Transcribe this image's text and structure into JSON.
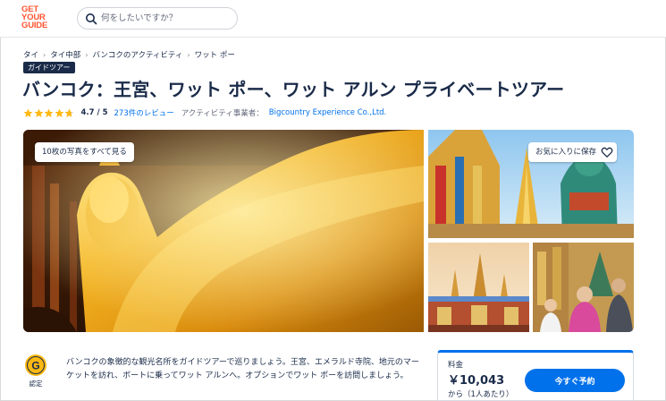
{
  "header": {
    "logo_lines": [
      "GET",
      "YOUR",
      "GUIDE"
    ],
    "search_placeholder": "何をしたいですか？"
  },
  "breadcrumb": [
    "タイ",
    "タイ中部",
    "バンコクのアクティビティ",
    "ワット ポー"
  ],
  "badge": "ガイドツアー",
  "title": "バンコク：王宮、ワット ポー、ワット アルン プライベートツアー",
  "rating": {
    "stars": 4.7,
    "value_text": "4.7 / 5",
    "reviews_text": "273件のレビュー",
    "provider_label": "アクティビティ事業者：",
    "provider_name": "Bigcountry Experience Co.,Ltd."
  },
  "gallery": {
    "photos_button": "10枚の写真をすべて見る",
    "wishlist_button": "お気に入りに保存"
  },
  "certified": {
    "label": "認定"
  },
  "description": "バンコクの象徴的な観光名所をガイドツアーで巡りましょう。王宮、エメラルド寺院、地元のマーケットを訪れ、ボートに乗ってワット アルンへ。オプションでワット ポーを訪問しましょう。",
  "price": {
    "label": "料金",
    "value": "￥10,043",
    "unit": "から（1人あたり）",
    "book_button": "今すぐ予約"
  },
  "colors": {
    "brand": "#ff5533",
    "accent": "#0071eb",
    "text": "#1a2b49",
    "star": "#fdb913"
  }
}
